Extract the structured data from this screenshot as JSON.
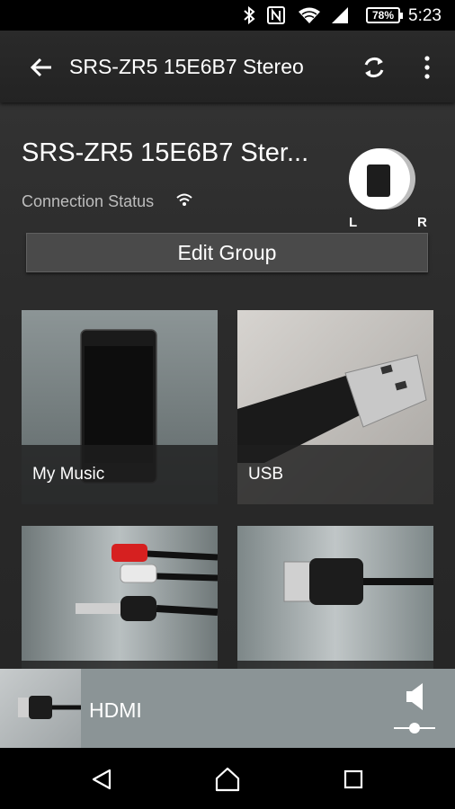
{
  "status_bar": {
    "icons": [
      "bluetooth-icon",
      "nfc-icon",
      "wifi-icon",
      "signal-icon"
    ],
    "battery": "78%",
    "time": "5:23"
  },
  "app_bar": {
    "title": "SRS-ZR5 15E6B7 Stereo",
    "icons": [
      "back-arrow-icon",
      "refresh-icon",
      "overflow-menu-icon"
    ]
  },
  "device": {
    "name": "SRS-ZR5 15E6B7 Ster...",
    "connection_label": "Connection Status",
    "left_label": "L",
    "right_label": "R"
  },
  "edit_group_label": "Edit Group",
  "sources": [
    {
      "label": "My Music"
    },
    {
      "label": "USB"
    },
    {
      "label": ""
    },
    {
      "label": ""
    }
  ],
  "now_playing": {
    "source": "HDMI"
  },
  "colors": {
    "accent_bg": "#2b2b2b",
    "now_playing_bg": "#8b9496"
  }
}
